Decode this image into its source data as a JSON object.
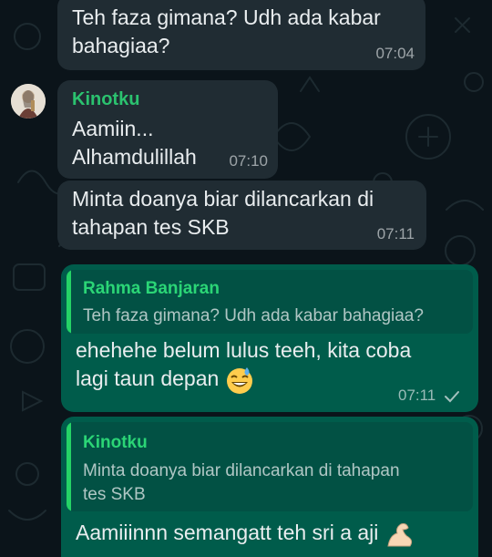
{
  "colors": {
    "background": "#0b141a",
    "incoming_bubble": "#202c33",
    "outgoing_bubble": "#005c4b",
    "quote_background": "#025144",
    "sender_name": "#2bc26f",
    "quote_bar": "#25d366"
  },
  "messages": [
    {
      "direction": "incoming",
      "text_lines": [
        "Teh faza gimana? Udh ada kabar",
        "bahagiaa?"
      ],
      "time": "07:04"
    },
    {
      "direction": "incoming",
      "sender": "Kinotku",
      "avatar_icon": "profile-avatar",
      "text_lines": [
        "Aamiin...",
        "Alhamdulillah"
      ],
      "time": "07:10"
    },
    {
      "direction": "incoming",
      "text_lines": [
        "Minta doanya biar dilancarkan di",
        "tahapan tes SKB"
      ],
      "time": "07:11"
    },
    {
      "direction": "outgoing",
      "quote": {
        "name": "Rahma Banjaran",
        "text": "Teh faza gimana? Udh ada kabar bahagiaa?"
      },
      "text_lines": [
        "ehehehe belum lulus teeh, kita coba",
        "lagi taun depan"
      ],
      "emoji": "sweat-smile-emoji",
      "time": "07:11",
      "status_icon": "single-check-icon"
    },
    {
      "direction": "outgoing",
      "quote": {
        "name": "Kinotku",
        "text_lines": [
          "Minta doanya biar dilancarkan di tahapan",
          "tes SKB"
        ]
      },
      "text_lines": [
        "Aamiiinnn semangatt teh sri a aji"
      ],
      "emoji": "flexed-biceps-emoji"
    }
  ]
}
